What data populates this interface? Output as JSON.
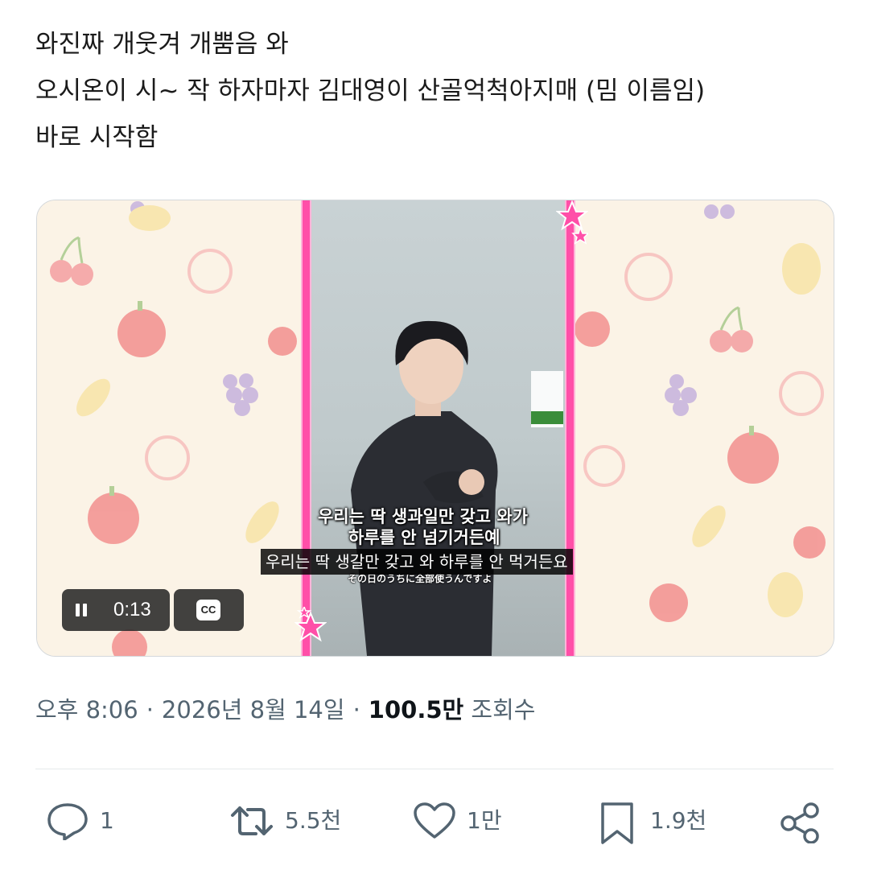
{
  "tweet": {
    "lines": [
      "와진짜 개웃겨 개뿜음 와",
      "오시온이 시~ 작 하자마자 김대영이 산골억척아지매 (밈 이름임)",
      "바로 시작함"
    ]
  },
  "video": {
    "burned_subtitle_line1": "우리는 딱 생과일만 갖고 와가",
    "burned_subtitle_line2": "하루를 안 넘기거든예",
    "burned_subtitle_jp": "その日のうちに全部使うんですよ",
    "caption": "우리는 딱 생갈만 갖고 와 하루를 안 먹거든요",
    "time": "0:13",
    "cc_label": "CC",
    "play_state": "pause-icon"
  },
  "meta": {
    "time": "오후 8:06",
    "date": "2026년 8월 14일",
    "views_count": "100.5만",
    "views_label": "조회수"
  },
  "actions": {
    "reply_count": "1",
    "retweet_count": "5.5천",
    "like_count": "1만",
    "bookmark_count": "1.9천"
  },
  "colors": {
    "frame_pink": "#ff4fa8",
    "meta_gray": "#536471"
  }
}
